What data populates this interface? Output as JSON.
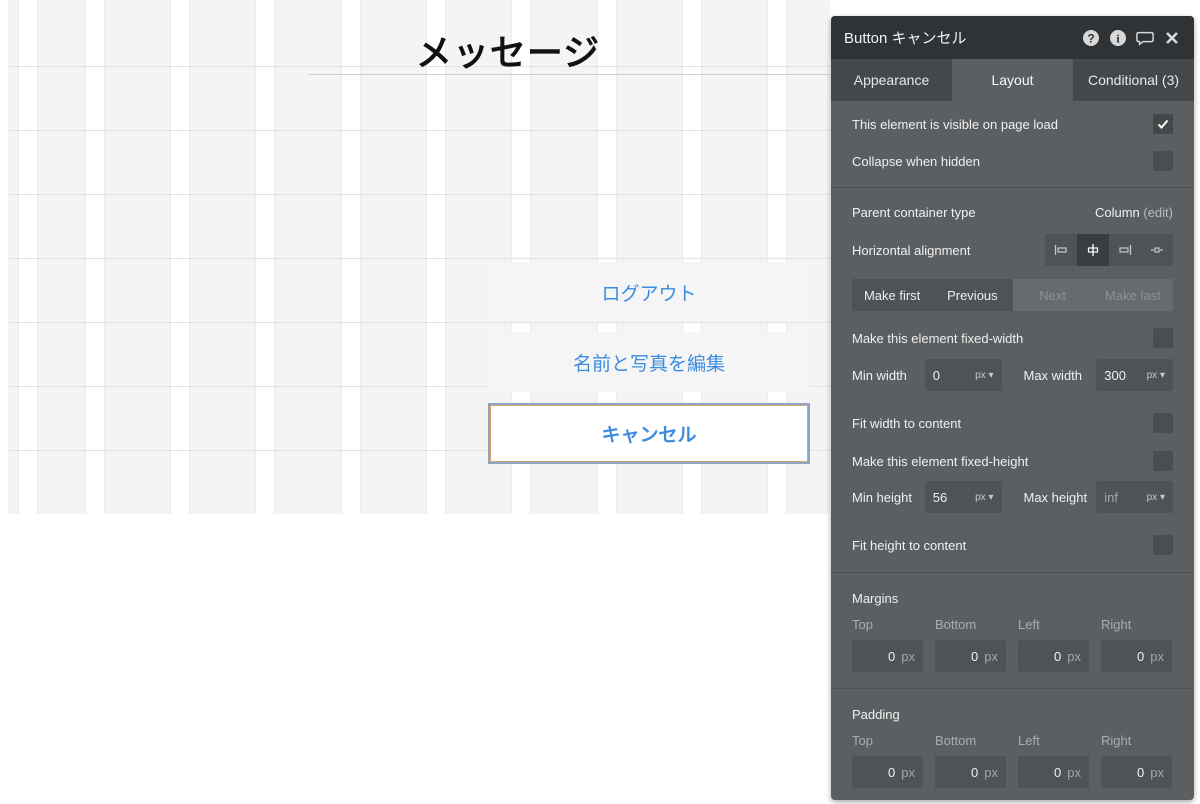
{
  "canvas": {
    "page_title": "メッセージ",
    "buttons": [
      {
        "label": "ログアウト"
      },
      {
        "label": "名前と写真を編集"
      },
      {
        "label": "キャンセル"
      }
    ]
  },
  "panel": {
    "title": "Button キャンセル",
    "header_icons": [
      "help-icon",
      "info-icon",
      "comment-icon",
      "close-icon"
    ],
    "tabs": [
      {
        "label": "Appearance",
        "active": false
      },
      {
        "label": "Layout",
        "active": true
      },
      {
        "label": "Conditional (3)",
        "active": false
      }
    ],
    "visible_on_load": {
      "label": "This element is visible on page load",
      "checked": true
    },
    "collapse_when_hidden": {
      "label": "Collapse when hidden",
      "checked": false
    },
    "parent_container": {
      "label": "Parent container type",
      "value": "Column",
      "edit": "(edit)"
    },
    "horizontal_alignment": {
      "label": "Horizontal alignment",
      "options": [
        "align-left",
        "align-center",
        "align-right",
        "align-stretch"
      ],
      "selected": "align-center"
    },
    "order_buttons": [
      "Make first",
      "Previous",
      "Next",
      "Make last"
    ],
    "fixed_width": {
      "label": "Make this element fixed-width",
      "checked": false
    },
    "min_width": {
      "label": "Min width",
      "value": "0",
      "unit": "px"
    },
    "max_width": {
      "label": "Max width",
      "value": "300",
      "unit": "px"
    },
    "fit_width": {
      "label": "Fit width to content",
      "checked": false
    },
    "fixed_height": {
      "label": "Make this element fixed-height",
      "checked": false
    },
    "min_height": {
      "label": "Min height",
      "value": "56",
      "unit": "px"
    },
    "max_height": {
      "label": "Max height",
      "placeholder": "inf",
      "unit": "px"
    },
    "fit_height": {
      "label": "Fit height to content",
      "checked": false
    },
    "margins": {
      "label": "Margins",
      "sides": [
        "Top",
        "Bottom",
        "Left",
        "Right"
      ],
      "values": [
        "0",
        "0",
        "0",
        "0"
      ],
      "unit": "px"
    },
    "padding": {
      "label": "Padding",
      "sides": [
        "Top",
        "Bottom",
        "Left",
        "Right"
      ],
      "values": [
        "0",
        "0",
        "0",
        "0"
      ],
      "unit": "px"
    }
  },
  "colors": {
    "panel_bg": "#5b5f62",
    "panel_header": "#2f3336",
    "link_blue": "#3c8ce0"
  }
}
